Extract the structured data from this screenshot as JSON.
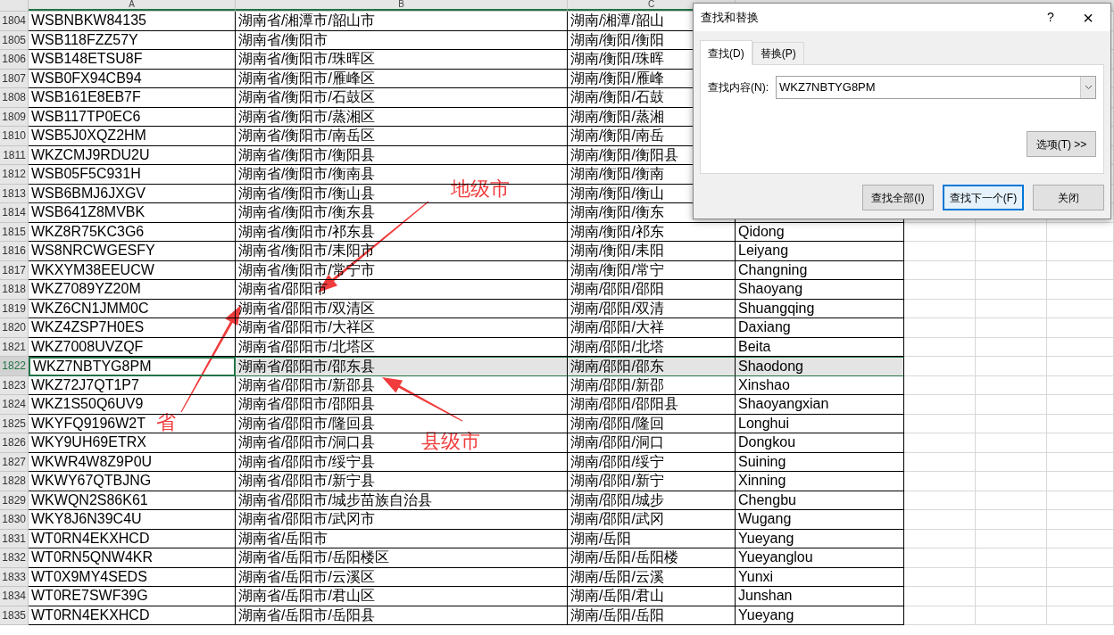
{
  "sheet": {
    "columns": [
      "A",
      "B",
      "C"
    ],
    "rows": [
      {
        "number": "1804",
        "selected": false,
        "cells": [
          "WSBNBKW84135",
          "湖南省/湘潭市/韶山市",
          "湖南/湘潭/韶山"
        ]
      },
      {
        "number": "1805",
        "selected": false,
        "cells": [
          "WSB118FZZ57Y",
          "湖南省/衡阳市",
          "湖南/衡阳/衡阳"
        ]
      },
      {
        "number": "1806",
        "selected": false,
        "cells": [
          "WSB148ETSU8F",
          "湖南省/衡阳市/珠晖区",
          "湖南/衡阳/珠晖"
        ]
      },
      {
        "number": "1807",
        "selected": false,
        "cells": [
          "WSB0FX94CB94",
          "湖南省/衡阳市/雁峰区",
          "湖南/衡阳/雁峰"
        ]
      },
      {
        "number": "1808",
        "selected": false,
        "cells": [
          "WSB161E8EB7F",
          "湖南省/衡阳市/石鼓区",
          "湖南/衡阳/石鼓"
        ]
      },
      {
        "number": "1809",
        "selected": false,
        "cells": [
          "WSB117TP0EC6",
          "湖南省/衡阳市/蒸湘区",
          "湖南/衡阳/蒸湘"
        ]
      },
      {
        "number": "1810",
        "selected": false,
        "cells": [
          "WSB5J0XQZ2HM",
          "湖南省/衡阳市/南岳区",
          "湖南/衡阳/南岳"
        ]
      },
      {
        "number": "1811",
        "selected": false,
        "cells": [
          "WKZCMJ9RDU2U",
          "湖南省/衡阳市/衡阳县",
          "湖南/衡阳/衡阳县"
        ]
      },
      {
        "number": "1812",
        "selected": false,
        "cells": [
          "WSB05F5C931H",
          "湖南省/衡阳市/衡南县",
          "湖南/衡阳/衡南"
        ]
      },
      {
        "number": "1813",
        "selected": false,
        "cells": [
          "WSB6BMJ6JXGV",
          "湖南省/衡阳市/衡山县",
          "湖南/衡阳/衡山"
        ]
      },
      {
        "number": "1814",
        "selected": false,
        "cells": [
          "WSB641Z8MVBK",
          "湖南省/衡阳市/衡东县",
          "湖南/衡阳/衡东"
        ]
      },
      {
        "number": "1815",
        "selected": false,
        "cells": [
          "WKZ8R75KC3G6",
          "湖南省/衡阳市/祁东县",
          "湖南/衡阳/祁东",
          "Qidong"
        ]
      },
      {
        "number": "1816",
        "selected": false,
        "cells": [
          "WS8NRCWGESFY",
          "湖南省/衡阳市/耒阳市",
          "湖南/衡阳/耒阳",
          "Leiyang"
        ]
      },
      {
        "number": "1817",
        "selected": false,
        "cells": [
          "WKXYM38EEUCW",
          "湖南省/衡阳市/常宁市",
          "湖南/衡阳/常宁",
          "Changning"
        ]
      },
      {
        "number": "1818",
        "selected": false,
        "cells": [
          "WKZ7089YZ20M",
          "湖南省/邵阳市",
          "湖南/邵阳/邵阳",
          "Shaoyang"
        ]
      },
      {
        "number": "1819",
        "selected": false,
        "cells": [
          "WKZ6CN1JMM0C",
          "湖南省/邵阳市/双清区",
          "湖南/邵阳/双清",
          "Shuangqing"
        ]
      },
      {
        "number": "1820",
        "selected": false,
        "cells": [
          "WKZ4ZSP7H0ES",
          "湖南省/邵阳市/大祥区",
          "湖南/邵阳/大祥",
          "Daxiang"
        ]
      },
      {
        "number": "1821",
        "selected": false,
        "cells": [
          "WKZ7008UVZQF",
          "湖南省/邵阳市/北塔区",
          "湖南/邵阳/北塔",
          "Beita"
        ]
      },
      {
        "number": "1822",
        "selected": true,
        "cells": [
          "WKZ7NBTYG8PM",
          "湖南省/邵阳市/邵东县",
          "湖南/邵阳/邵东",
          "Shaodong"
        ]
      },
      {
        "number": "1823",
        "selected": false,
        "cells": [
          "WKZ72J7QT1P7",
          "湖南省/邵阳市/新邵县",
          "湖南/邵阳/新邵",
          "Xinshao"
        ]
      },
      {
        "number": "1824",
        "selected": false,
        "cells": [
          "WKZ1S50Q6UV9",
          "湖南省/邵阳市/邵阳县",
          "湖南/邵阳/邵阳县",
          "Shaoyangxian"
        ]
      },
      {
        "number": "1825",
        "selected": false,
        "cells": [
          "WKYFQ9196W2T",
          "湖南省/邵阳市/隆回县",
          "湖南/邵阳/隆回",
          "Longhui"
        ]
      },
      {
        "number": "1826",
        "selected": false,
        "cells": [
          "WKY9UH69ETRX",
          "湖南省/邵阳市/洞口县",
          "湖南/邵阳/洞口",
          "Dongkou"
        ]
      },
      {
        "number": "1827",
        "selected": false,
        "cells": [
          "WKWR4W8Z9P0U",
          "湖南省/邵阳市/绥宁县",
          "湖南/邵阳/绥宁",
          "Suining"
        ]
      },
      {
        "number": "1828",
        "selected": false,
        "cells": [
          "WKWY67QTBJNG",
          "湖南省/邵阳市/新宁县",
          "湖南/邵阳/新宁",
          "Xinning"
        ]
      },
      {
        "number": "1829",
        "selected": false,
        "cells": [
          "WKWQN2S86K61",
          "湖南省/邵阳市/城步苗族自治县",
          "湖南/邵阳/城步",
          "Chengbu"
        ]
      },
      {
        "number": "1830",
        "selected": false,
        "cells": [
          "WKY8J6N39C4U",
          "湖南省/邵阳市/武冈市",
          "湖南/邵阳/武冈",
          "Wugang"
        ]
      },
      {
        "number": "1831",
        "selected": false,
        "cells": [
          "WT0RN4EKXHCD",
          "湖南省/岳阳市",
          "湖南/岳阳",
          "Yueyang"
        ]
      },
      {
        "number": "1832",
        "selected": false,
        "cells": [
          "WT0RN5QNW4KR",
          "湖南省/岳阳市/岳阳楼区",
          "湖南/岳阳/岳阳楼",
          "Yueyanglou"
        ]
      },
      {
        "number": "1833",
        "selected": false,
        "cells": [
          "WT0X9MY4SEDS",
          "湖南省/岳阳市/云溪区",
          "湖南/岳阳/云溪",
          "Yunxi"
        ]
      },
      {
        "number": "1834",
        "selected": false,
        "cells": [
          "WT0RE7SWF39G",
          "湖南省/岳阳市/君山区",
          "湖南/岳阳/君山",
          "Junshan"
        ]
      },
      {
        "number": "1835",
        "selected": false,
        "cells": [
          "WT0RN4EKXHCD",
          "湖南省/岳阳市/岳阳县",
          "湖南/岳阳/岳阳",
          "Yueyang"
        ]
      }
    ]
  },
  "annotations": [
    {
      "text": "地级市"
    },
    {
      "text": "省"
    },
    {
      "text": "县级市"
    }
  ],
  "dialog": {
    "title": "查找和替换",
    "help": "?",
    "close": "×",
    "tabs": [
      {
        "label": "查找(D)",
        "selected": true
      },
      {
        "label": "替换(P)",
        "selected": false
      }
    ],
    "find_label": "查找内容(N):",
    "find_value": "WKZ7NBTYG8PM",
    "options_button": "选项(T) >>",
    "buttons": [
      {
        "label": "查找全部(I)",
        "focused": false
      },
      {
        "label": "查找下一个(F)",
        "focused": true
      },
      {
        "label": "关闭",
        "focused": false
      }
    ]
  }
}
